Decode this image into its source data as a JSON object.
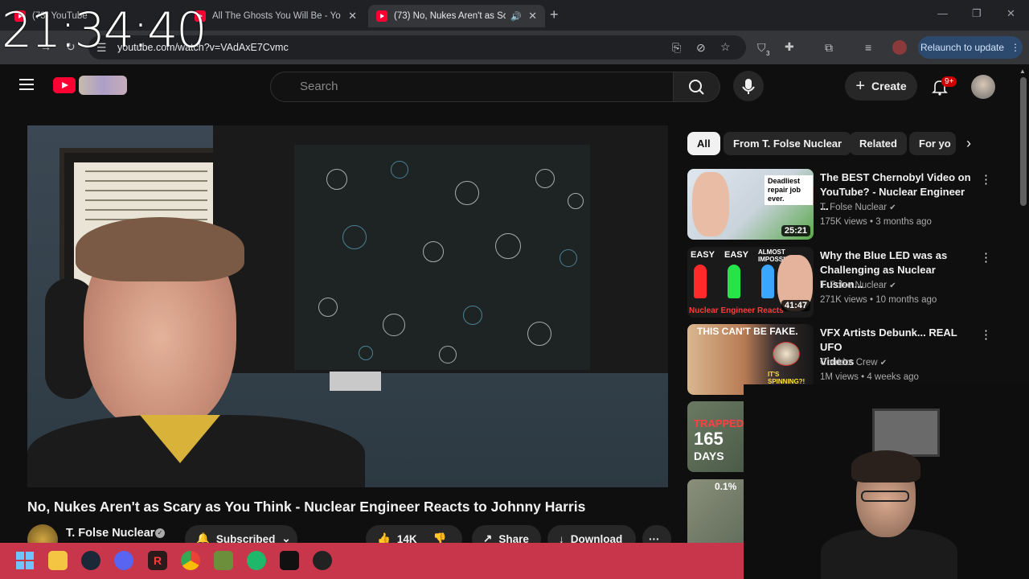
{
  "clock": "21:34:40",
  "browser": {
    "tabs": [
      {
        "title": "(73) YouTube"
      },
      {
        "title": "All The Ghosts You Will Be - Yo"
      },
      {
        "title": "(73) No, Nukes Aren't as Sc"
      }
    ],
    "new_tab": "+",
    "url": "youtube.com/watch?v=VAdAxE7Cvmc",
    "relaunch_label": "Relaunch to update",
    "ext_badge": "3"
  },
  "masthead": {
    "search_placeholder": "Search",
    "create_label": "Create",
    "notification_count": "9+"
  },
  "video": {
    "title": "No, Nukes Aren't as Scary as You Think - Nuclear Engineer Reacts to Johnny Harris",
    "channel": "T. Folse Nuclear",
    "subscribed_label": "Subscribed",
    "likes": "14K",
    "share_label": "Share",
    "download_label": "Download",
    "more_label": "···"
  },
  "chips": [
    {
      "label": "All",
      "active": true
    },
    {
      "label": "From T. Folse Nuclear"
    },
    {
      "label": "Related"
    },
    {
      "label": "For yo"
    }
  ],
  "recommendations": [
    {
      "title_line1": "The BEST Chernobyl Video on",
      "title_line2": "YouTube? - Nuclear Engineer ...",
      "channel": "T. Folse Nuclear",
      "meta": "175K views • 3 months ago",
      "duration": "25:21",
      "thumb_text": "Deadliest repair job ever."
    },
    {
      "title_line1": "Why the Blue LED was as",
      "title_line2": "Challenging as Nuclear Fusion...",
      "channel": "T. Folse Nuclear",
      "meta": "271K views • 10 months ago",
      "duration": "41:47",
      "thumb_easy1": "EASY",
      "thumb_easy2": "EASY",
      "thumb_almost": "ALMOST IMPOSSIBLE",
      "thumb_caption": "Nuclear Engineer Reacts"
    },
    {
      "title_line1": "VFX Artists Debunk... REAL UFO",
      "title_line2": "Videos",
      "channel": "Corridor Crew",
      "meta": "1M views • 4 weeks ago",
      "thumb_text1": "THIS CAN'T BE FAKE.",
      "thumb_text2": "IT'S SPINNING?!"
    },
    {
      "thumb_text1": "TRAPPED",
      "thumb_text2": "165",
      "thumb_text3": "DAYS"
    },
    {
      "thumb_text1": "0.1%"
    }
  ],
  "colors": {
    "youtube_red": "#ff0033",
    "taskbar": "#c7364a",
    "chip_active": "#f1f1f1",
    "background": "#0f0f0f"
  }
}
